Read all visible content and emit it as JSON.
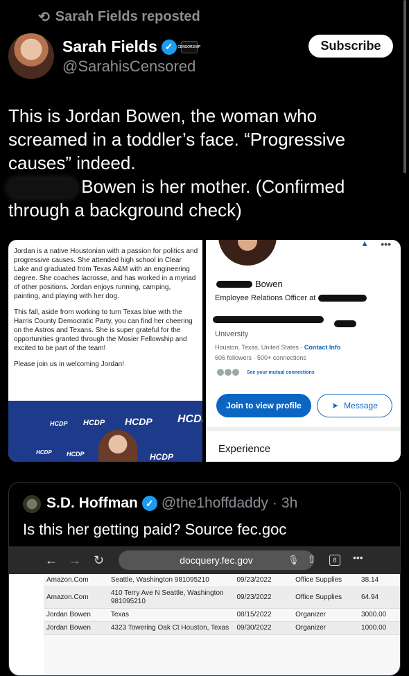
{
  "repost": {
    "label": "Sarah Fields reposted"
  },
  "author": {
    "name": "Sarah Fields",
    "handle": "@SarahisCensored",
    "badge_text": "CENSORSHIP"
  },
  "subscribe": {
    "label": "Subscribe"
  },
  "post": {
    "line1": "This is Jordan Bowen, the woman who screamed in a toddler’s face. “Progressive causes” indeed.",
    "line2": "Bowen is her mother. (Confirmed through a background check)"
  },
  "bio": {
    "p1": "Jordan is a native Houstonian with a passion for politics and progressive causes. She attended high school in Clear Lake and graduated from Texas A&M with an engineering degree. She coaches lacrosse, and has worked in a myriad of other positions. Jordan enjoys running, camping, painting, and playing with her dog.",
    "p2": "This fall, aside from working to turn Texas blue with the Harris County Democratic Party, you can find her cheering on the Astros and Texans. She is super grateful for the opportunities granted through the Mosier Fellowship and excited to be part of the team!",
    "p3": "Please join us in welcoming Jordan!",
    "logo": "HCDP"
  },
  "linkedin": {
    "name": "Bowen",
    "title": "Employee Relations Officer at",
    "university": "University",
    "location": "Houston, Texas, United States",
    "contact": "Contact Info",
    "followers": "606 followers",
    "connections": "500+ connections",
    "mutual": "See your mutual connections",
    "join": "Join to view profile",
    "message": "Message",
    "experience": "Experience"
  },
  "quote": {
    "name": "S.D. Hoffman",
    "handle": "@the1hoffdaddy",
    "time": "3h",
    "text": "Is this her getting paid? Source fec.goc"
  },
  "browser": {
    "url": "docquery.fec.gov",
    "tabs": "8"
  },
  "fec_table": [
    {
      "name": "Amazon.Com",
      "address": "Seattle, Washington 981095210",
      "date": "09/23/2022",
      "purpose": "Office Supplies",
      "amount": "38.14"
    },
    {
      "name": "Amazon.Com",
      "address": "410 Terry Ave N Seattle, Washington 981095210",
      "date": "09/23/2022",
      "purpose": "Office Supplies",
      "amount": "64.94"
    },
    {
      "name": "Jordan Bowen",
      "address": "Texas",
      "date": "08/15/2022",
      "purpose": "Organizer",
      "amount": "3000.00"
    },
    {
      "name": "Jordan Bowen",
      "address": "4323 Towering Oak Ct Houston, Texas",
      "date": "09/30/2022",
      "purpose": "Organizer",
      "amount": "1000.00"
    }
  ]
}
